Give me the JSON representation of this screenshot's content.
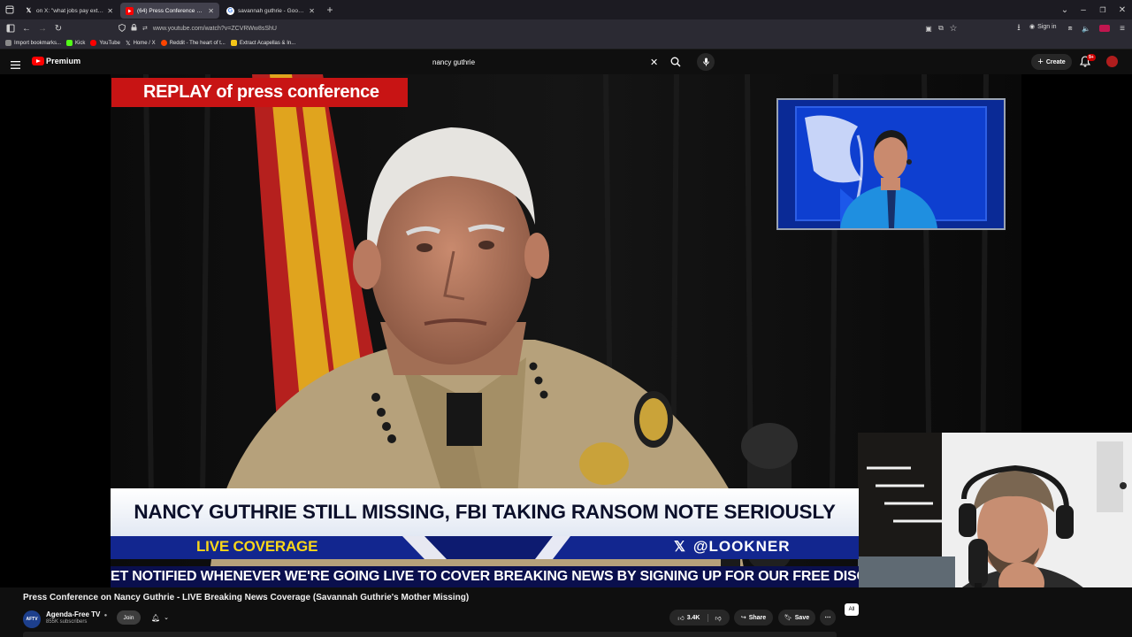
{
  "browser": {
    "tabs": [
      {
        "title": "on X: \"what jobs pay extren",
        "favicon": "x-icon",
        "active": false
      },
      {
        "title": "(64) Press Conference on Nanc",
        "favicon": "youtube-icon",
        "active": true
      },
      {
        "title": "savannah guthrie - Google Sea",
        "favicon": "google-icon",
        "active": false
      }
    ],
    "url": "www.youtube.com/watch?v=ZCVRWw8sShU",
    "sign_in": "Sign in",
    "bookmarks": [
      {
        "label": "Import bookmarks...",
        "color": "#8a8a8a"
      },
      {
        "label": "Kick",
        "color": "#53fc18"
      },
      {
        "label": "YouTube",
        "color": "#ff0000"
      },
      {
        "label": "Home / X",
        "color": "#ffffff"
      },
      {
        "label": "Reddit - The heart of t...",
        "color": "#ff4500"
      },
      {
        "label": "Extract Acapellas & In...",
        "color": "#f5c518"
      }
    ]
  },
  "youtube": {
    "brand": "Premium",
    "search_value": "nancy guthrie",
    "create_label": "Create",
    "notification_count": "9+"
  },
  "video": {
    "replay_banner": "REPLAY of press conference",
    "headline": "NANCY GUTHRIE STILL MISSING, FBI TAKING RANSOM NOTE SERIOUSLY",
    "live_label": "LIVE COVERAGE",
    "handle": "@LOOKNER",
    "ticker": "ET NOTIFIED WHENEVER WE'RE GOING LIVE TO COVER BREAKING NEWS BY SIGNING UP FOR OUR FREE DISCORD NOTIF"
  },
  "below": {
    "title": "Press Conference on Nancy Guthrie - LIVE Breaking News Coverage (Savannah Guthrie's Mother Missing)",
    "channel_name": "Agenda-Free TV",
    "subscribers": "855K subscribers",
    "join_label": "Join",
    "like_count": "3.4K",
    "share_label": "Share",
    "save_label": "Save",
    "chip_all": "All",
    "avatar_text": "AFTV"
  }
}
